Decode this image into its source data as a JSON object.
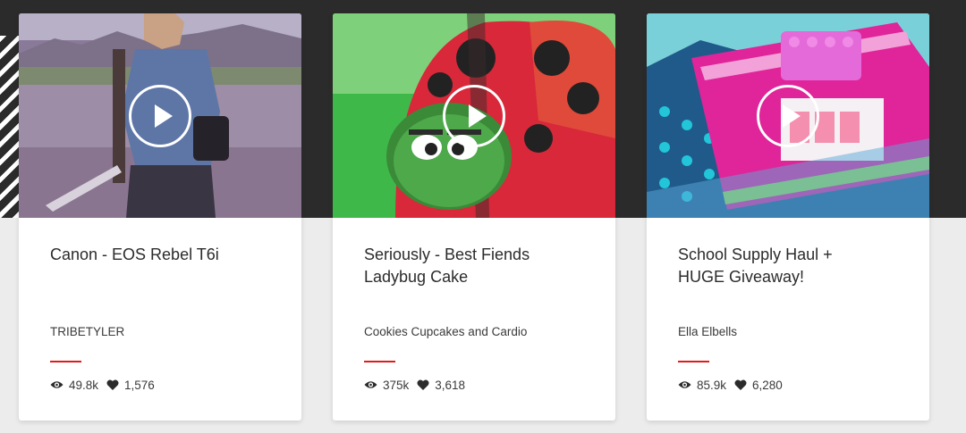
{
  "videos": [
    {
      "title_line1": "Canon - EOS Rebel T6i",
      "title_line2": "",
      "channel": "TRIBETYLER",
      "views": "49.8k",
      "likes": "1,576"
    },
    {
      "title_line1": "Seriously - Best Fiends",
      "title_line2": "Ladybug Cake",
      "channel": "Cookies Cupcakes and Cardio",
      "views": "375k",
      "likes": "3,618"
    },
    {
      "title_line1": "School Supply Haul +",
      "title_line2": "HUGE Giveaway!",
      "channel": "Ella Elbells",
      "views": "85.9k",
      "likes": "6,280"
    }
  ],
  "icons": {
    "play": "play-icon",
    "views": "eye-icon",
    "likes": "heart-icon"
  },
  "colors": {
    "accent": "#e01b1b",
    "band": "#2b2b2b",
    "background": "#ececec"
  }
}
